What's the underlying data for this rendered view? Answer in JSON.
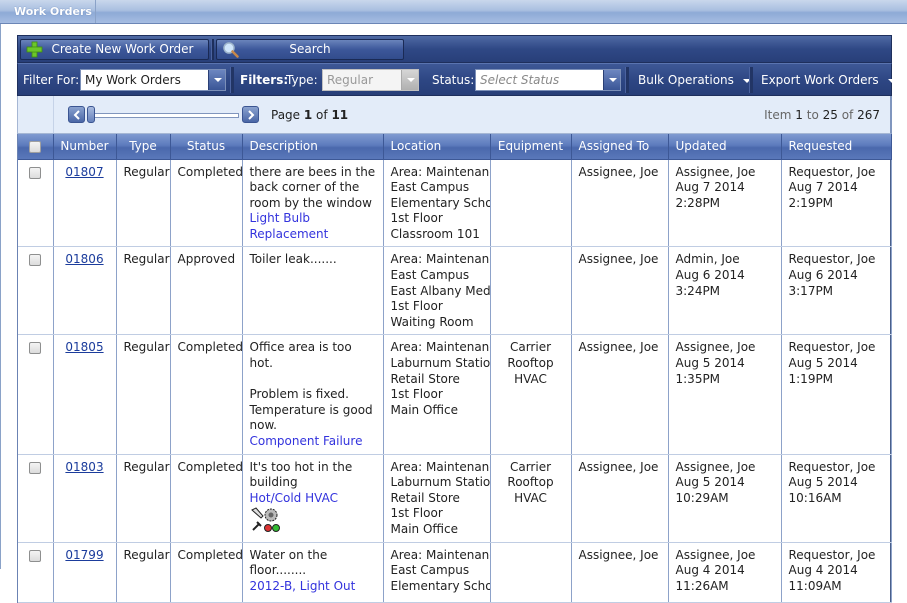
{
  "tab": {
    "label": "Work Orders"
  },
  "toolbar": {
    "create_label": "Create New Work Order",
    "search_label": "Search"
  },
  "filters": {
    "filter_for_label": "Filter For:",
    "filter_for_value": "My Work Orders",
    "filters_label": "Filters:",
    "type_label": "Type:",
    "type_value": "Regular",
    "status_label": "Status:",
    "status_placeholder": "Select Status",
    "bulk_label": "Bulk Operations",
    "export_label": "Export Work Orders"
  },
  "pager": {
    "page_prefix": "Page ",
    "page_current": "1",
    "page_of": " of ",
    "page_total": "11",
    "item_prefix": "Item ",
    "item_from": "1",
    "item_to_word": " to ",
    "item_to": "25",
    "item_of_word": " of ",
    "item_total": "267",
    "slider_position": 0
  },
  "columns": [
    "Number",
    "Type",
    "Status",
    "Description",
    "Location",
    "Equipment",
    "Assigned To",
    "Updated",
    "Requested"
  ],
  "rows": [
    {
      "number": "01807",
      "type": "Regular",
      "status": "Completed",
      "description": [
        "there are bees in the back corner of the room by the window"
      ],
      "category": "Light Bulb Replacement",
      "location": [
        "Area: Maintenance",
        "East Campus",
        "Elementary School",
        "1st Floor",
        "Classroom 101"
      ],
      "equipment": [],
      "assigned": "Assignee, Joe",
      "updated": [
        "Assignee, Joe",
        "Aug 7 2014",
        "2:28PM"
      ],
      "requested": [
        "Requestor, Joe",
        "Aug 7 2014",
        "2:19PM"
      ]
    },
    {
      "number": "01806",
      "type": "Regular",
      "status": "Approved",
      "description": [
        "Toiler leak......."
      ],
      "category": "",
      "location": [
        "Area: Maintenance",
        "East Campus",
        "East Albany Medical",
        "1st Floor",
        "Waiting Room"
      ],
      "equipment": [],
      "assigned": "Assignee, Joe",
      "updated": [
        "Admin, Joe",
        "Aug 6 2014",
        "3:24PM"
      ],
      "requested": [
        "Requestor, Joe",
        "Aug 6 2014",
        "3:17PM"
      ]
    },
    {
      "number": "01805",
      "type": "Regular",
      "status": "Completed",
      "description": [
        "Office area is too hot.",
        "",
        "Problem is fixed.",
        " Temperature is good now."
      ],
      "category": "Component Failure",
      "location": [
        "Area: Maintenance",
        "Laburnum Station",
        "Retail Store",
        "1st Floor",
        "Main Office"
      ],
      "equipment": [
        "Carrier",
        "Rooftop",
        "HVAC"
      ],
      "assigned": "Assignee, Joe",
      "updated": [
        "Assignee, Joe",
        "Aug 5 2014",
        "1:35PM"
      ],
      "requested": [
        "Requestor, Joe",
        "Aug 5 2014",
        "1:19PM"
      ]
    },
    {
      "number": "01803",
      "type": "Regular",
      "status": "Completed",
      "description": [
        "It's too hot in the building"
      ],
      "category": "Hot/Cold HVAC",
      "has_tools_icon": true,
      "location": [
        "Area: Maintenance",
        "Laburnum Station",
        "Retail Store",
        "1st Floor",
        "Main Office"
      ],
      "equipment": [
        "Carrier",
        "Rooftop",
        "HVAC"
      ],
      "assigned": "Assignee, Joe",
      "updated": [
        "Assignee, Joe",
        "Aug 5 2014",
        "10:29AM"
      ],
      "requested": [
        "Requestor, Joe",
        "Aug 5 2014",
        "10:16AM"
      ]
    },
    {
      "number": "01799",
      "type": "Regular",
      "status": "Completed",
      "description": [
        "Water on the floor........"
      ],
      "category": "2012-B, Light Out",
      "location": [
        "Area: Maintenance",
        "East Campus",
        "Elementary School"
      ],
      "equipment": [],
      "assigned": "Assignee, Joe",
      "updated": [
        "Assignee, Joe",
        "Aug 4 2014",
        "11:26AM"
      ],
      "requested": [
        "Requestor, Joe",
        "Aug 4 2014",
        "11:09AM"
      ]
    }
  ],
  "colors": {
    "toolbar_dark": "#2f4885",
    "header_blue": "#5d7bbd",
    "link_blue": "#1b3c9c",
    "category_blue": "#3333dd",
    "pager_bg": "#e3ecf9"
  }
}
